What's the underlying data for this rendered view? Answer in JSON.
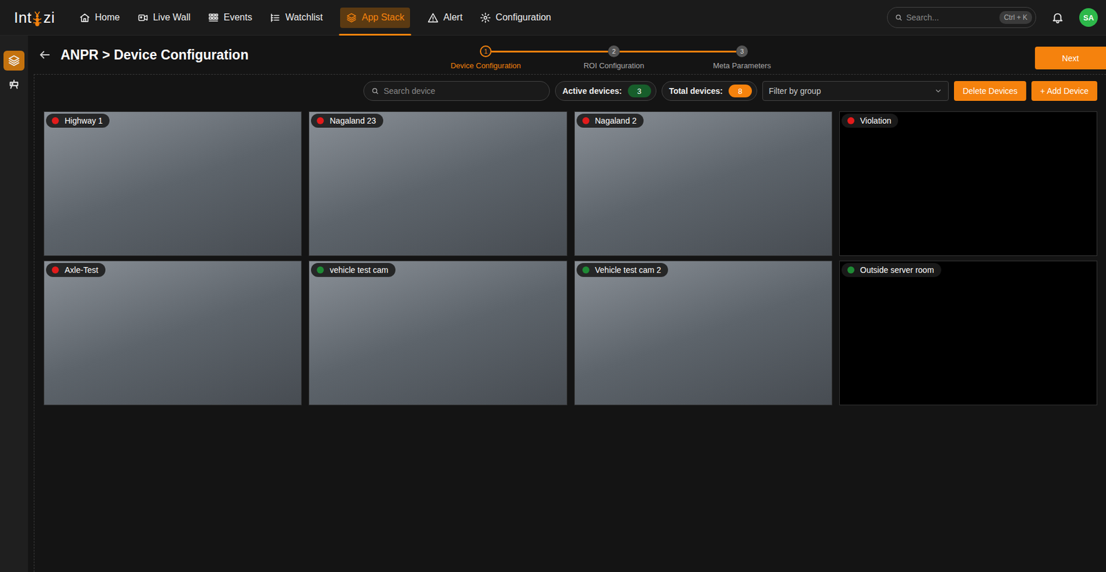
{
  "logo": {
    "before": "Int",
    "after": "zi"
  },
  "nav": [
    {
      "label": "Home",
      "selected": false
    },
    {
      "label": "Live Wall",
      "selected": false
    },
    {
      "label": "Events",
      "selected": false
    },
    {
      "label": "Watchlist",
      "selected": false
    },
    {
      "label": "App Stack",
      "selected": true
    },
    {
      "label": "Alert",
      "selected": false
    },
    {
      "label": "Configuration",
      "selected": false
    }
  ],
  "search": {
    "placeholder": "Search...",
    "shortcut": "Ctrl + K"
  },
  "user": {
    "initials": "SA"
  },
  "sidebar": {
    "items": [
      {
        "name": "app-stack",
        "selected": true
      },
      {
        "name": "cameras",
        "selected": false
      }
    ]
  },
  "breadcrumb": "ANPR > Device Configuration",
  "steps": [
    {
      "number": "1",
      "label": "Device Configuration",
      "active": true
    },
    {
      "number": "2",
      "label": "ROI Configuration",
      "active": false
    },
    {
      "number": "3",
      "label": "Meta Parameters",
      "active": false
    }
  ],
  "next_button": "Next",
  "toolbar": {
    "search_placeholder": "Search device",
    "active_label": "Active devices:",
    "active_count": "3",
    "total_label": "Total devices:",
    "total_count": "8",
    "filter_placeholder": "Filter by group",
    "delete_button": "Delete Devices",
    "add_button": "+ Add Device"
  },
  "devices": [
    {
      "name": "Highway 1",
      "online": false,
      "color": "#e21b1b",
      "has_feed": true
    },
    {
      "name": "Nagaland 23",
      "online": false,
      "color": "#e21b1b",
      "has_feed": true
    },
    {
      "name": "Nagaland 2",
      "online": false,
      "color": "#e21b1b",
      "has_feed": true
    },
    {
      "name": "Violation",
      "online": false,
      "color": "#e21b1b",
      "has_feed": false
    },
    {
      "name": "Axle-Test",
      "online": false,
      "color": "#e21b1b",
      "has_feed": true
    },
    {
      "name": "vehicle test cam",
      "online": true,
      "color": "#1f8a35",
      "has_feed": true
    },
    {
      "name": "Vehicle test cam 2",
      "online": true,
      "color": "#1f8a35",
      "has_feed": true
    },
    {
      "name": "Outside server room",
      "online": true,
      "color": "#1f8a35",
      "has_feed": false
    }
  ]
}
